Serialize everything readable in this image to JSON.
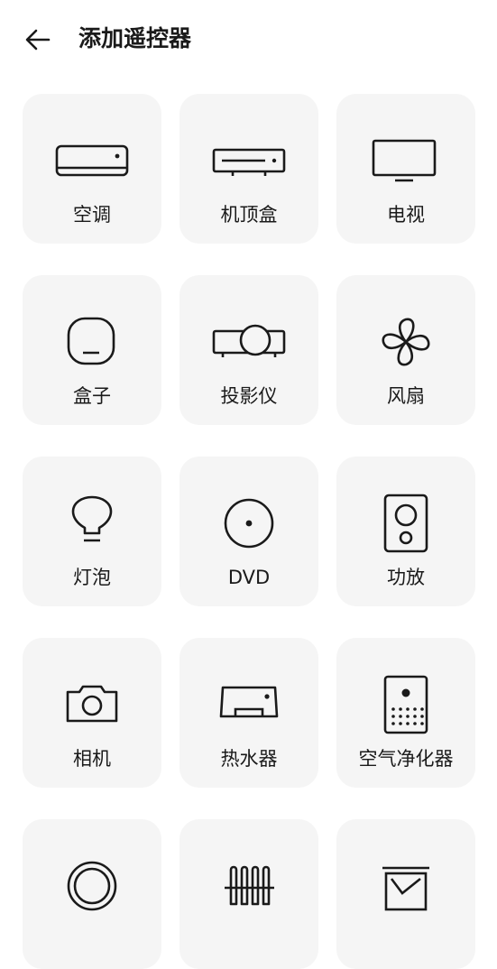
{
  "header": {
    "title": "添加遥控器"
  },
  "devices": [
    {
      "label": "空调"
    },
    {
      "label": "机顶盒"
    },
    {
      "label": "电视"
    },
    {
      "label": "盒子"
    },
    {
      "label": "投影仪"
    },
    {
      "label": "风扇"
    },
    {
      "label": "灯泡"
    },
    {
      "label": "DVD"
    },
    {
      "label": "功放"
    },
    {
      "label": "相机"
    },
    {
      "label": "热水器"
    },
    {
      "label": "空气净化器"
    },
    {
      "label": ""
    },
    {
      "label": ""
    },
    {
      "label": ""
    }
  ],
  "icons": [
    "air-conditioner-icon",
    "set-top-box-icon",
    "tv-icon",
    "box-icon",
    "projector-icon",
    "fan-icon",
    "bulb-icon",
    "dvd-icon",
    "amplifier-icon",
    "camera-icon",
    "water-heater-icon",
    "air-purifier-icon",
    "ring-icon",
    "heater-icon",
    "frame-icon"
  ],
  "colors": {
    "tile_bg": "#f5f5f5",
    "icon_stroke": "#1a1a1a",
    "background": "#ffffff"
  }
}
